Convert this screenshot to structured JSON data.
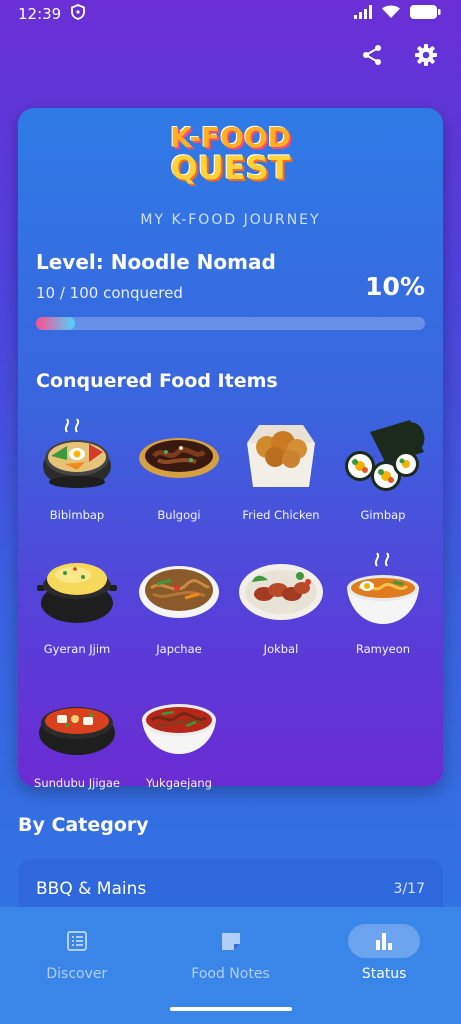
{
  "status_bar": {
    "time": "12:39"
  },
  "card": {
    "logo": {
      "line1": "K-FOOD",
      "line2": "QUEST"
    },
    "subtitle": "MY K-FOOD JOURNEY",
    "level": "Level: Noodle Nomad",
    "conquered": "10 / 100 conquered",
    "percent": "10%",
    "progress_fraction": 0.1,
    "section_title": "Conquered Food Items",
    "foods": [
      {
        "name": "Bibimbap",
        "icon": "bibimbap-icon"
      },
      {
        "name": "Bulgogi",
        "icon": "bulgogi-icon"
      },
      {
        "name": "Fried Chicken",
        "icon": "fried-chicken-icon"
      },
      {
        "name": "Gimbap",
        "icon": "gimbap-icon"
      },
      {
        "name": "Gyeran Jjim",
        "icon": "gyeran-jjim-icon"
      },
      {
        "name": "Japchae",
        "icon": "japchae-icon"
      },
      {
        "name": "Jokbal",
        "icon": "jokbal-icon"
      },
      {
        "name": "Ramyeon",
        "icon": "ramyeon-icon"
      },
      {
        "name": "Sundubu Jjigae",
        "icon": "sundubu-jjigae-icon"
      },
      {
        "name": "Yukgaejang",
        "icon": "yukgaejang-icon"
      }
    ]
  },
  "categories": {
    "title": "By Category",
    "items": [
      {
        "name": "BBQ & Mains",
        "count": "3/17"
      }
    ]
  },
  "nav": {
    "items": [
      {
        "label": "Discover",
        "icon": "list-icon",
        "active": false
      },
      {
        "label": "Food Notes",
        "icon": "note-icon",
        "active": false
      },
      {
        "label": "Status",
        "icon": "bar-chart-icon",
        "active": true
      }
    ]
  },
  "colors": {
    "progress_start": "#ff4d8d",
    "progress_end": "#4fd3ff",
    "nav_bg": "#3a85e8"
  }
}
